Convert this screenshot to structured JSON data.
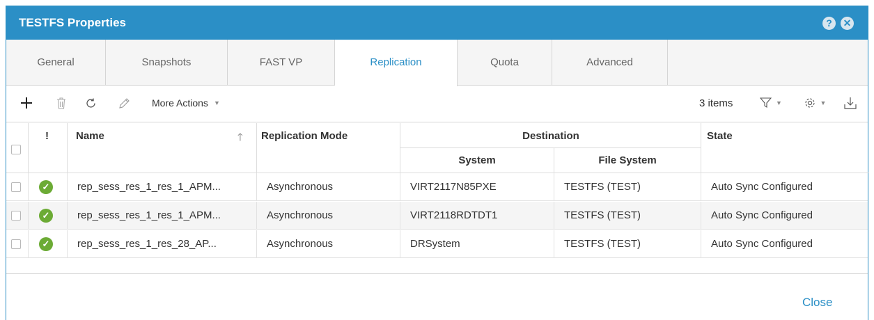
{
  "dialog": {
    "title": "TESTFS Properties",
    "help_icon": "help-icon",
    "close_icon": "close-icon",
    "close_label": "Close"
  },
  "tabs": [
    {
      "label": "General",
      "active": false
    },
    {
      "label": "Snapshots",
      "active": false
    },
    {
      "label": "FAST VP",
      "active": false
    },
    {
      "label": "Replication",
      "active": true
    },
    {
      "label": "Quota",
      "active": false
    },
    {
      "label": "Advanced",
      "active": false
    }
  ],
  "toolbar": {
    "add_icon": "plus-icon",
    "delete_icon": "trash-icon",
    "refresh_icon": "refresh-icon",
    "edit_icon": "pencil-icon",
    "more_actions_label": "More Actions",
    "items_count": "3 items",
    "filter_icon": "filter-icon",
    "settings_icon": "gear-icon",
    "export_icon": "download-icon"
  },
  "table": {
    "headers": {
      "alert": "!",
      "name": "Name",
      "replication_mode": "Replication Mode",
      "destination": "Destination",
      "system": "System",
      "file_system": "File System",
      "state": "State"
    },
    "rows": [
      {
        "name": "rep_sess_res_1_res_1_APM...",
        "mode": "Asynchronous",
        "system": "VIRT2117N85PXE",
        "file_system": "TESTFS (TEST)",
        "state": "Auto Sync Configured"
      },
      {
        "name": "rep_sess_res_1_res_1_APM...",
        "mode": "Asynchronous",
        "system": "VIRT2118RDTDT1",
        "file_system": "TESTFS (TEST)",
        "state": "Auto Sync Configured"
      },
      {
        "name": "rep_sess_res_1_res_28_AP...",
        "mode": "Asynchronous",
        "system": "DRSystem",
        "file_system": "TESTFS (TEST)",
        "state": "Auto Sync Configured"
      }
    ]
  },
  "colors": {
    "accent": "#2b8fc6",
    "status_ok": "#6cab35"
  }
}
